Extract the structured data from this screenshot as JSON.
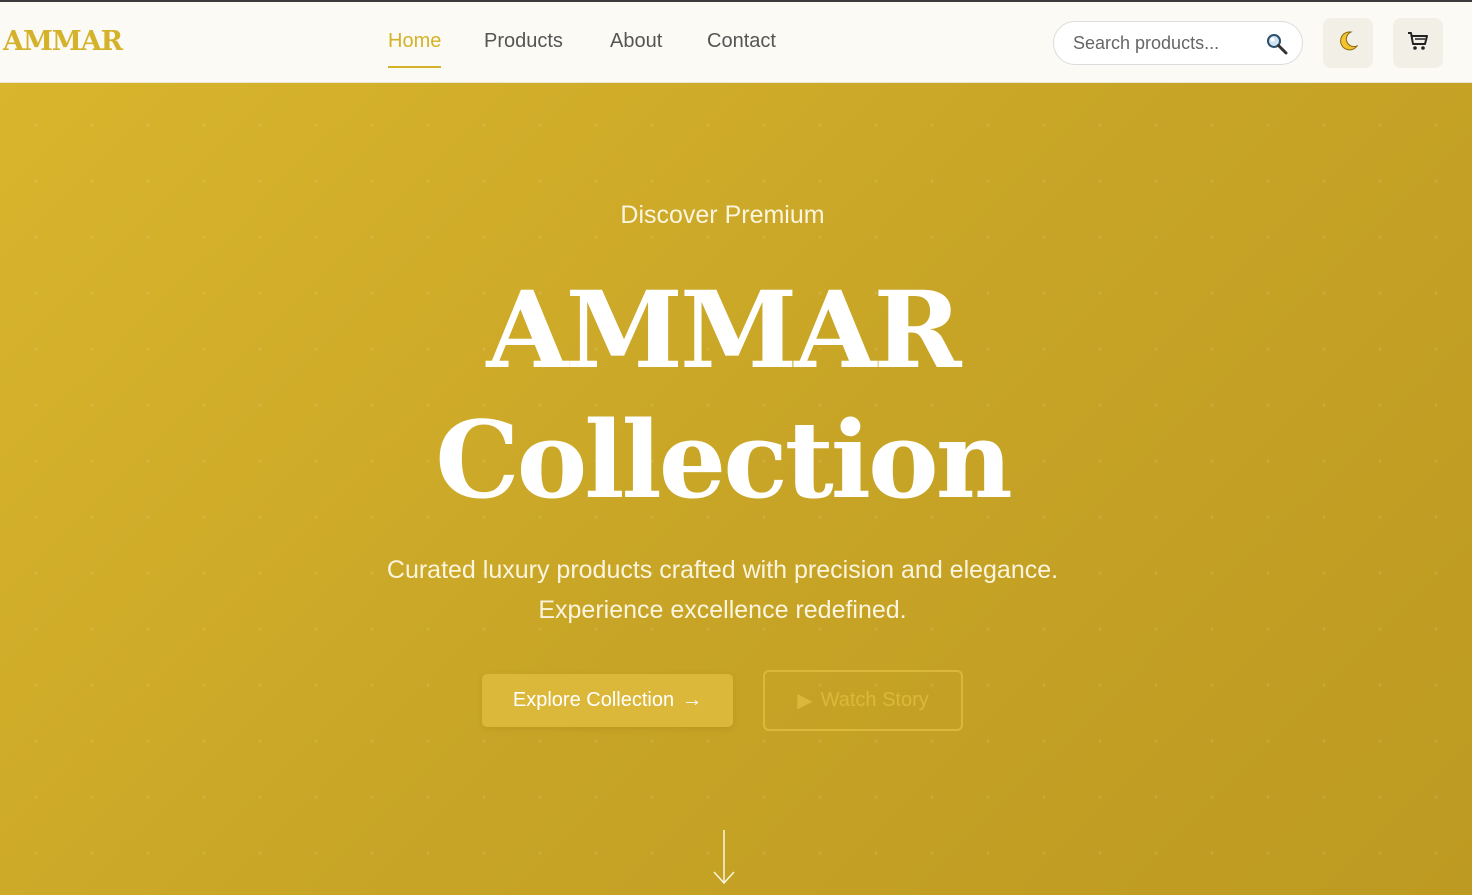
{
  "brand": {
    "logo": "AMMAR",
    "accent_color": "#d4b22a"
  },
  "nav": {
    "items": [
      {
        "label": "Home",
        "active": true
      },
      {
        "label": "Products",
        "active": false
      },
      {
        "label": "About",
        "active": false
      },
      {
        "label": "Contact",
        "active": false
      }
    ]
  },
  "search": {
    "placeholder": "Search products...",
    "icon": "magnifier-icon"
  },
  "actions": {
    "theme_icon": "moon-icon",
    "cart_icon": "cart-icon"
  },
  "hero": {
    "eyebrow": "Discover Premium",
    "title_line1": "AMMAR",
    "title_line2": "Collection",
    "subtitle_line1": "Curated luxury products crafted with precision and elegance.",
    "subtitle_line2": "Experience excellence redefined.",
    "primary_button": {
      "label": "Explore Collection",
      "icon": "→"
    },
    "secondary_button": {
      "label": "Watch Story",
      "icon": "▶"
    },
    "scroll_icon": "arrow-down-icon",
    "background_colors": [
      "#d9b52d",
      "#bd9a21"
    ]
  }
}
